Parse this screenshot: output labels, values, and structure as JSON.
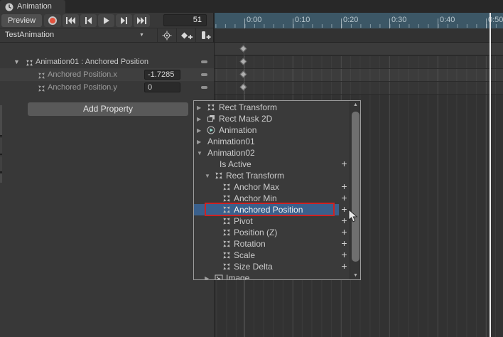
{
  "tab": {
    "title": "Animation"
  },
  "transport": {
    "preview": "Preview",
    "frame": "51",
    "buttons": [
      "record",
      "skip-to-start",
      "step-back",
      "play",
      "step-forward",
      "skip-to-end"
    ]
  },
  "clip": {
    "name": "TestAnimation"
  },
  "clip_toolbar_icons": [
    "filter-curves",
    "add-keyframe",
    "add-event"
  ],
  "ruler": {
    "labels": [
      "0:00",
      "0:10",
      "0:20",
      "0:30",
      "0:40",
      "0:50"
    ]
  },
  "properties": {
    "rows": [
      {
        "label": "Animation01 : Anchored Position",
        "value": null,
        "expanded": true
      },
      {
        "label": "Anchored Position.x",
        "value": "-1.7285"
      },
      {
        "label": "Anchored Position.y",
        "value": "0"
      }
    ],
    "add_button": "Add Property"
  },
  "dopesheet": {
    "keyframes": [
      {
        "row": 0,
        "frame": 0
      },
      {
        "row": 1,
        "frame": 0
      },
      {
        "row": 2,
        "frame": 0
      },
      {
        "row": 3,
        "frame": 0
      }
    ]
  },
  "dropdown": {
    "items": [
      {
        "label": "Rect Transform",
        "indent": 0,
        "arrow": "right",
        "icon": "rect-transform"
      },
      {
        "label": "Rect Mask 2D",
        "indent": 0,
        "arrow": "right",
        "icon": "rect-mask"
      },
      {
        "label": "Animation",
        "indent": 0,
        "arrow": "right",
        "icon": "animation"
      },
      {
        "label": "Animation01",
        "indent": 0,
        "arrow": "right"
      },
      {
        "label": "Animation02",
        "indent": 0,
        "arrow": "down"
      },
      {
        "label": "Is Active",
        "indent": 1,
        "plus": true
      },
      {
        "label": "Rect Transform",
        "indent": 1,
        "arrow": "down",
        "icon": "rect-transform"
      },
      {
        "label": "Anchor Max",
        "indent": 2,
        "icon": "rect-transform",
        "plus": true
      },
      {
        "label": "Anchor Min",
        "indent": 2,
        "icon": "rect-transform",
        "plus": true
      },
      {
        "label": "Anchored Position",
        "indent": 2,
        "icon": "rect-transform",
        "plus": true,
        "selected": true
      },
      {
        "label": "Pivot",
        "indent": 2,
        "icon": "rect-transform",
        "plus": true
      },
      {
        "label": "Position (Z)",
        "indent": 2,
        "icon": "rect-transform",
        "plus": true
      },
      {
        "label": "Rotation",
        "indent": 2,
        "icon": "rect-transform",
        "plus": true
      },
      {
        "label": "Scale",
        "indent": 2,
        "icon": "rect-transform",
        "plus": true
      },
      {
        "label": "Size Delta",
        "indent": 2,
        "icon": "rect-transform",
        "plus": true
      },
      {
        "label": "Image",
        "indent": 1,
        "arrow": "right",
        "icon": "image"
      }
    ]
  },
  "annotation": {
    "type": "red-outline-box",
    "target": "Anchored Position"
  },
  "icons": {
    "tab": "clock-icon",
    "record": "record-circle-icon",
    "tree_collapsed": "chevron-right-icon",
    "tree_expanded": "chevron-down-icon",
    "rect-transform": "four-arrows-icon",
    "rect-mask": "layered-rects-icon",
    "animation": "play-circle-icon",
    "image": "picture-icon",
    "context_menu": "pill-icon"
  },
  "colors": {
    "selection_blue": "#3A608C",
    "annotation_red": "#CE2222",
    "record_red": "#E2513C",
    "ruler_background": "#3C5766",
    "ruler_text": "#BAC8CF",
    "playhead": "#ECECEC",
    "keyframe": "#B0B0B0",
    "panel_background": "#383838",
    "dopesheet_background": "#323232"
  }
}
